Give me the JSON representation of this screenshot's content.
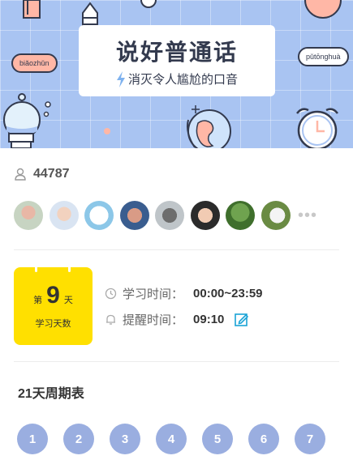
{
  "banner": {
    "title": "说好普通话",
    "subtitle": "消灭令人尴尬的口音",
    "bubble_left": "biǎozhǔn",
    "bubble_right": "pǔtōnghuà"
  },
  "participants": {
    "count": "44787",
    "avatars": [
      "avatar-1",
      "avatar-2",
      "avatar-3",
      "avatar-4",
      "avatar-5",
      "avatar-6",
      "avatar-7",
      "avatar-8"
    ],
    "more": "•••"
  },
  "study": {
    "day_prefix": "第",
    "day_number": "9",
    "day_suffix": "天",
    "days_label": "学习天数",
    "study_time_label": "学习时间：",
    "study_time_value": "00:00~23:59",
    "reminder_label": "提醒时间：",
    "reminder_value": "09:10"
  },
  "schedule": {
    "title": "21天周期表",
    "days": [
      "1",
      "2",
      "3",
      "4",
      "5",
      "6",
      "7"
    ]
  },
  "colors": {
    "accent_blue": "#9aaee0",
    "calendar_yellow": "#ffe000",
    "edit_icon": "#1aa3d6"
  }
}
